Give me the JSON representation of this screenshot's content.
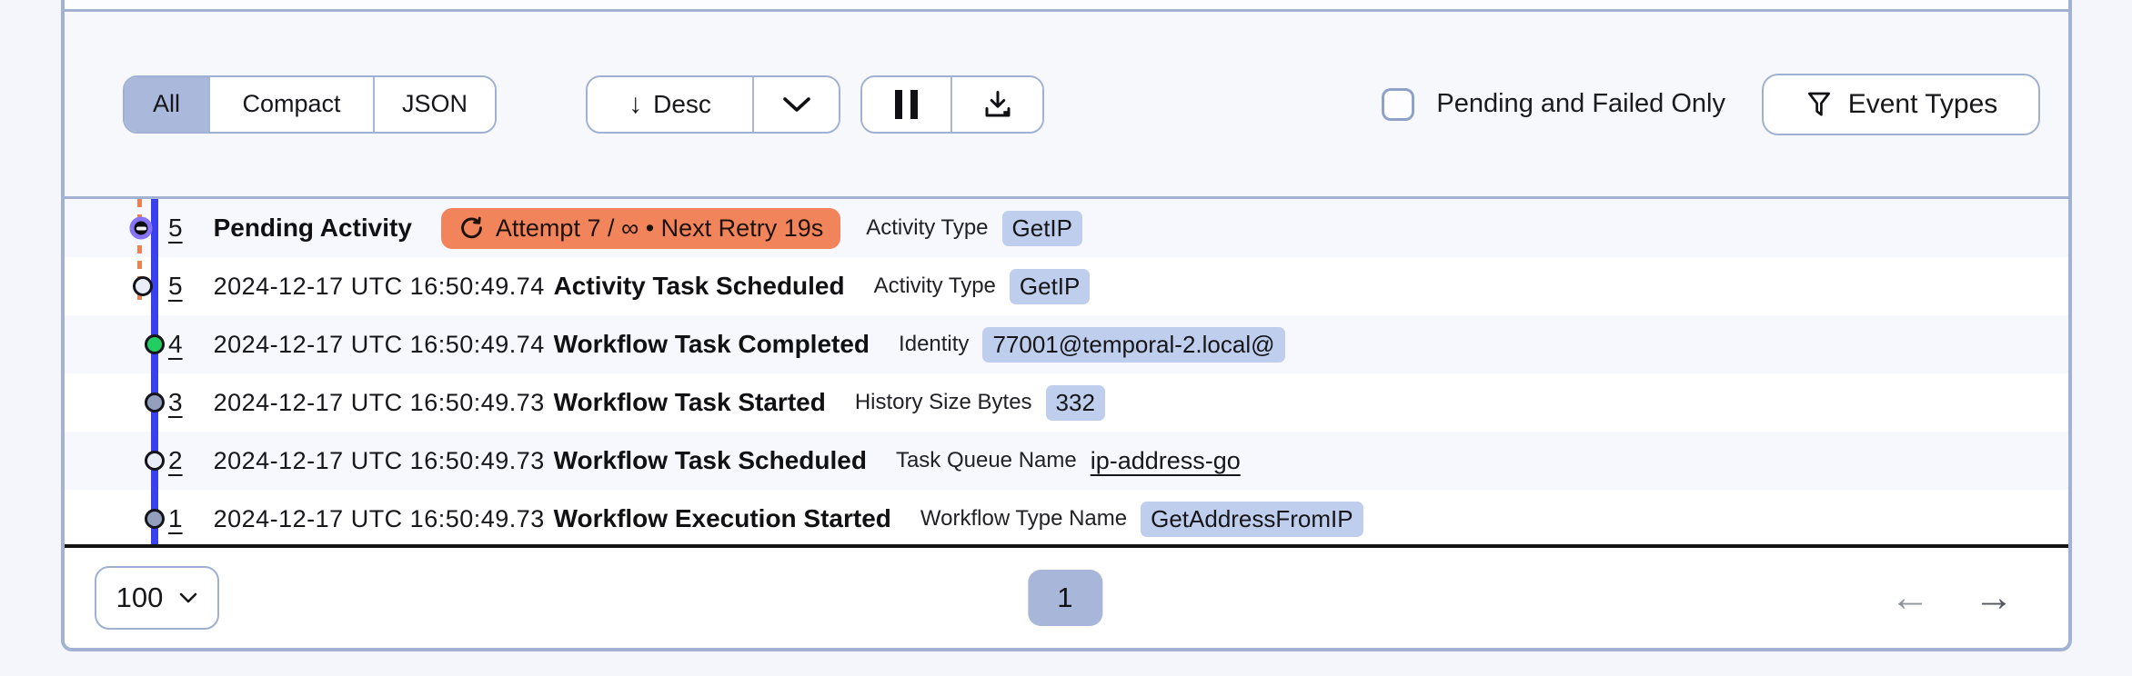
{
  "toolbar": {
    "view_tabs": [
      {
        "label": "All",
        "active": true
      },
      {
        "label": "Compact",
        "active": false
      },
      {
        "label": "JSON",
        "active": false
      }
    ],
    "sort": {
      "label": "Desc",
      "icon": "arrow-down-icon",
      "caret_icon": "chevron-down-icon"
    },
    "pause_icon": "pause-icon",
    "download_icon": "download-icon",
    "pending_failed_label": "Pending and Failed Only",
    "pending_failed_checked": false,
    "event_types": {
      "label": "Event Types",
      "icon": "filter-icon"
    }
  },
  "events": {
    "rows": [
      {
        "id": "5",
        "time": "",
        "name": "Pending Activity",
        "retry": "Attempt 7 / ∞ • Next Retry 19s",
        "retry_icon": "retry-icon",
        "attr_label": "Activity Type",
        "attr_value": "GetIP",
        "attr_kind": "badge",
        "marker": "pending"
      },
      {
        "id": "5",
        "time": "2024-12-17 UTC 16:50:49.74",
        "name": "Activity Task Scheduled",
        "retry": "",
        "attr_label": "Activity Type",
        "attr_value": "GetIP",
        "attr_kind": "badge",
        "marker": "open"
      },
      {
        "id": "4",
        "time": "2024-12-17 UTC 16:50:49.74",
        "name": "Workflow Task Completed",
        "retry": "",
        "attr_label": "Identity",
        "attr_value": "77001@temporal-2.local@",
        "attr_kind": "badge",
        "marker": "green"
      },
      {
        "id": "3",
        "time": "2024-12-17 UTC 16:50:49.73",
        "name": "Workflow Task Started",
        "retry": "",
        "attr_label": "History Size Bytes",
        "attr_value": "332",
        "attr_kind": "badge",
        "marker": "slate"
      },
      {
        "id": "2",
        "time": "2024-12-17 UTC 16:50:49.73",
        "name": "Workflow Task Scheduled",
        "retry": "",
        "attr_label": "Task Queue Name",
        "attr_value": "ip-address-go",
        "attr_kind": "link",
        "marker": "open"
      },
      {
        "id": "1",
        "time": "2024-12-17 UTC 16:50:49.73",
        "name": "Workflow Execution Started",
        "retry": "",
        "attr_label": "Workflow Type Name",
        "attr_value": "GetAddressFromIP",
        "attr_kind": "badge",
        "marker": "slate"
      }
    ]
  },
  "pagination": {
    "page_size": "100",
    "current_page": "1",
    "prev_icon": "left-arrow-icon",
    "next_icon": "right-arrow-icon"
  },
  "colors": {
    "border_blue_gray": "#a3b2d2",
    "active_segment": "#a9b8db",
    "value_badge": "#bfceec",
    "retry_badge": "#f2845c",
    "timeline_line": "#3b40ee",
    "timeline_dashed": "#f08050",
    "marker_green": "#22ce63",
    "marker_slate": "#93a0bd",
    "marker_open": "#e8edf9",
    "marker_pending_ring": "#8673f7",
    "table_bottom_border": "#141414"
  }
}
